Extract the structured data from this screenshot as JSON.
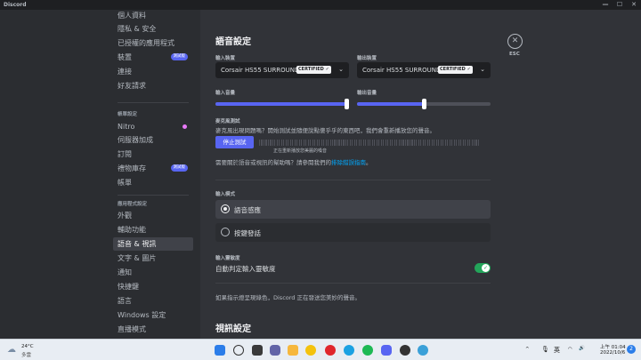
{
  "window": {
    "title": "Discord",
    "controls": [
      "—",
      "☐",
      "✕"
    ]
  },
  "sidebar": {
    "items_top": [
      "個人資料",
      "隱私 & 安全",
      "已授權的應用程式",
      "裝置",
      "連接",
      "好友請求"
    ],
    "badge_new": "測試版",
    "billing_header": "帳單設定",
    "billing_items": [
      "Nitro",
      "伺服器加成",
      "訂閱",
      "禮物庫存",
      "帳單"
    ],
    "app_header": "應用程式設定",
    "app_items": [
      "外觀",
      "輔助功能",
      "語音 & 視訊",
      "文字 & 圖片",
      "通知",
      "快捷鍵",
      "語言",
      "Windows 設定",
      "直播模式"
    ]
  },
  "voice": {
    "title": "語音設定",
    "input_device_label": "輸入裝置",
    "output_device_label": "輸出裝置",
    "input_device": "Corsair HS55 SURROUND",
    "output_device": "Corsair HS55 SURROUND",
    "certified": "CERTIFIED",
    "input_volume_label": "輸入音量",
    "output_volume_label": "輸出音量",
    "input_volume": 100,
    "output_volume": 50,
    "mic_test_label": "麥克風測試",
    "mic_test_desc": "麥克風出現問題嗎？開始測試並隨便說點傻乎乎的東西吧，我們會重新播放您的聲音。",
    "stop_test": "停止測試",
    "playback_note": "正在重新播放您美麗的嗓音",
    "help_text": "需要關於語音或視訊的幫助嗎？請參閱我們的",
    "help_link": "排除錯誤指南",
    "help_end": "。",
    "input_mode_label": "輸入模式",
    "mode_voice": "語音感應",
    "mode_ptt": "按鍵發話",
    "sensitivity_label": "輸入靈敏度",
    "auto_sensitivity": "自動判定輸入靈敏度",
    "auto_sensitivity_on": true,
    "sensitivity_note": "如果指示燈呈現綠色，Discord 正在發送您美妙的聲音。",
    "video_title": "視訊設定"
  },
  "close": {
    "label": "ESC",
    "icon": "close-icon"
  },
  "taskbar": {
    "weather_temp": "24°C",
    "weather_cond": "多雲",
    "ime": "英",
    "time": "上午 01:04",
    "date": "2022/10/6",
    "notif_count": "2"
  },
  "colors": {
    "accent": "#5865f2",
    "toggle_on": "#23a55a",
    "link": "#00a8fc"
  }
}
